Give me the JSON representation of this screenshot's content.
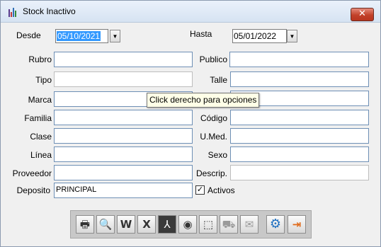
{
  "window": {
    "title": "Stock Inactivo",
    "close_label": "✕"
  },
  "dates": {
    "desde_label": "Desde",
    "desde_value": "05/10/2021",
    "hasta_label": "Hasta",
    "hasta_value": "05/01/2022"
  },
  "left_fields": [
    {
      "label": "Rubro",
      "value": ""
    },
    {
      "label": "Tipo",
      "value": ""
    },
    {
      "label": "Marca",
      "value": ""
    },
    {
      "label": "Familia",
      "value": ""
    },
    {
      "label": "Clase",
      "value": ""
    },
    {
      "label": "Línea",
      "value": ""
    },
    {
      "label": "Proveedor",
      "value": ""
    },
    {
      "label": "Deposito",
      "value": "PRINCIPAL"
    }
  ],
  "right_fields": [
    {
      "label": "Publico",
      "value": ""
    },
    {
      "label": "Talle",
      "value": ""
    },
    {
      "label": "",
      "value": ""
    },
    {
      "label": "Código",
      "value": ""
    },
    {
      "label": "U.Med.",
      "value": ""
    },
    {
      "label": "Sexo",
      "value": ""
    },
    {
      "label": "Descrip.",
      "value": ""
    }
  ],
  "activos": {
    "label": "Activos",
    "checked": true,
    "mark": "✓"
  },
  "tooltip": "Click derecho para opciones",
  "toolbar": {
    "buttons": [
      {
        "icon": "printer-icon",
        "glyph": "🖶"
      },
      {
        "icon": "preview-icon",
        "glyph": "🔍"
      },
      {
        "icon": "word-icon",
        "glyph": "W"
      },
      {
        "icon": "excel-icon",
        "glyph": "X"
      },
      {
        "icon": "pdf-icon",
        "glyph": "⅄"
      },
      {
        "icon": "attach-icon",
        "glyph": "◉"
      },
      {
        "icon": "chart-icon",
        "glyph": "⬚"
      },
      {
        "icon": "cart-icon",
        "glyph": "⛟"
      },
      {
        "icon": "mail-icon",
        "glyph": "✉"
      },
      {
        "icon": "settings-gear-icon",
        "glyph": "⚙"
      },
      {
        "icon": "exit-door-icon",
        "glyph": "⇥"
      }
    ]
  },
  "colors": {
    "selection": "#3399ff",
    "input_border": "#6e8fb5",
    "close": "#c2412a"
  }
}
